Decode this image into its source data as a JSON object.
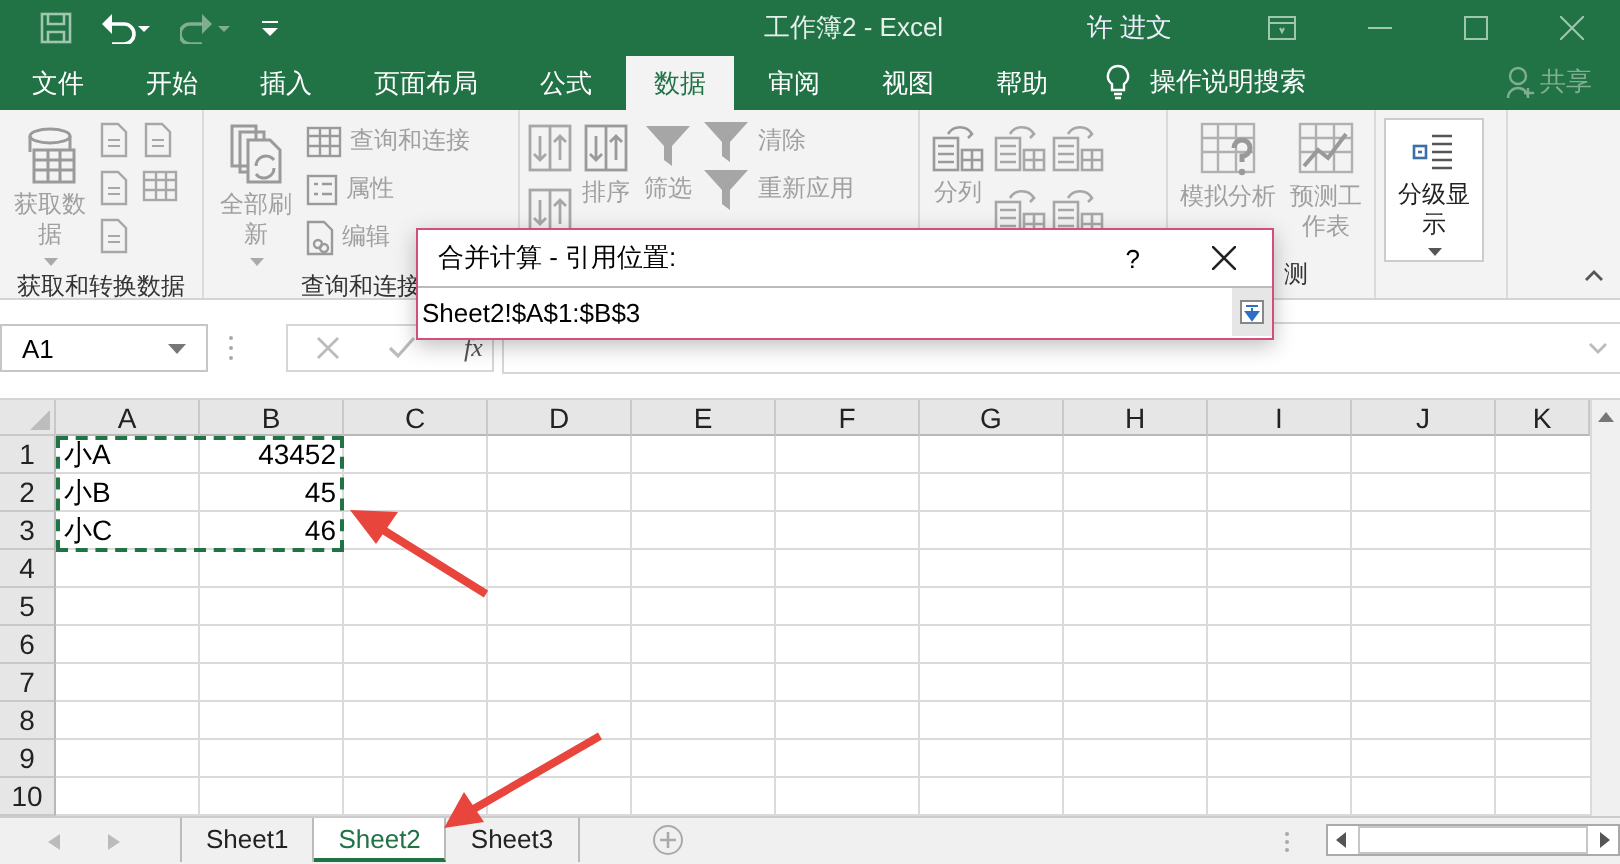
{
  "title_bar": {
    "title": "工作簿2  -  Excel",
    "user": "许 进文"
  },
  "tabs": [
    {
      "label": "文件",
      "selected": false
    },
    {
      "label": "开始",
      "selected": false
    },
    {
      "label": "插入",
      "selected": false
    },
    {
      "label": "页面布局",
      "selected": false
    },
    {
      "label": "公式",
      "selected": false
    },
    {
      "label": "数据",
      "selected": true
    },
    {
      "label": "审阅",
      "selected": false
    },
    {
      "label": "视图",
      "selected": false
    },
    {
      "label": "帮助",
      "selected": false
    }
  ],
  "search": {
    "label": "操作说明搜索"
  },
  "share": {
    "label": "共享"
  },
  "ribbon": {
    "groups": [
      {
        "label": "获取和转换数据",
        "columns": [
          {
            "kind": "large",
            "items": [
              {
                "label": "获取数据",
                "disabled": true,
                "dropdown": true
              }
            ]
          },
          {
            "kind": "icons",
            "items": [
              {
                "disabled": true
              },
              {
                "disabled": true
              },
              {
                "disabled": true
              },
              {
                "disabled": true
              },
              {
                "disabled": true
              }
            ]
          }
        ]
      },
      {
        "label": "查询和连接",
        "columns": [
          {
            "kind": "large",
            "items": [
              {
                "label": "全部刷新",
                "disabled": true,
                "dropdown": true
              }
            ]
          },
          {
            "kind": "small",
            "items": [
              {
                "label": "查询和连接",
                "disabled": true
              },
              {
                "label": "属性",
                "disabled": true
              },
              {
                "label": "编辑",
                "disabled": true
              }
            ]
          }
        ]
      },
      {
        "columns": [
          {
            "kind": "icons",
            "items": [
              {
                "disabled": true
              },
              {
                "disabled": true
              }
            ]
          },
          {
            "kind": "large",
            "items": [
              {
                "label": "排序",
                "disabled": true
              }
            ]
          },
          {
            "kind": "large",
            "items": [
              {
                "label": "筛选",
                "disabled": true
              }
            ]
          },
          {
            "kind": "small",
            "items": [
              {
                "label": "清除",
                "disabled": true
              },
              {
                "label": "重新应用",
                "disabled": true
              }
            ]
          }
        ]
      },
      {
        "columns": [
          {
            "kind": "large",
            "items": [
              {
                "label": "分列",
                "disabled": true
              }
            ]
          },
          {
            "kind": "icons",
            "items": [
              {
                "disabled": true
              },
              {
                "disabled": true
              }
            ]
          },
          {
            "kind": "icons",
            "items": [
              {
                "disabled": true
              },
              {
                "disabled": true
              }
            ]
          }
        ]
      },
      {
        "label": "测",
        "columns": [
          {
            "kind": "large",
            "items": [
              {
                "label": "模拟分析",
                "disabled": true
              }
            ]
          },
          {
            "kind": "large",
            "items": [
              {
                "label": "预测工作表",
                "disabled": true
              }
            ]
          }
        ]
      },
      {
        "columns": [
          {
            "kind": "large",
            "items": [
              {
                "label": "分级显示",
                "disabled": false,
                "dropdown": true
              }
            ]
          }
        ]
      }
    ]
  },
  "formula_bar": {
    "name_box": "A1",
    "fx": "fx"
  },
  "dialog": {
    "title": "合并计算 - 引用位置:",
    "help": "?",
    "value": "Sheet2!$A$1:$B$3"
  },
  "grid": {
    "columns": [
      "A",
      "B",
      "C",
      "D",
      "E",
      "F",
      "G",
      "H",
      "I",
      "J",
      "K"
    ],
    "rows": [
      {
        "header": "1",
        "marked": true,
        "cells": [
          {
            "kind": "text",
            "value": "小A"
          },
          {
            "kind": "number",
            "value": "43452"
          }
        ]
      },
      {
        "header": "2",
        "marked": true,
        "cells": [
          {
            "kind": "text",
            "value": "小B"
          },
          {
            "kind": "number",
            "value": "45"
          }
        ]
      },
      {
        "header": "3",
        "marked": true,
        "cells": [
          {
            "kind": "text",
            "value": "小C"
          },
          {
            "kind": "number",
            "value": "46"
          }
        ]
      },
      {
        "header": "4",
        "marked": false
      },
      {
        "header": "5",
        "marked": false
      },
      {
        "header": "6",
        "marked": false
      },
      {
        "header": "7",
        "marked": false
      },
      {
        "header": "8",
        "marked": false
      },
      {
        "header": "9",
        "marked": false
      },
      {
        "header": "10",
        "marked": false
      }
    ]
  },
  "sheets": [
    {
      "label": "Sheet1",
      "selected": false
    },
    {
      "label": "Sheet2",
      "selected": true
    },
    {
      "label": "Sheet3",
      "selected": false
    }
  ]
}
